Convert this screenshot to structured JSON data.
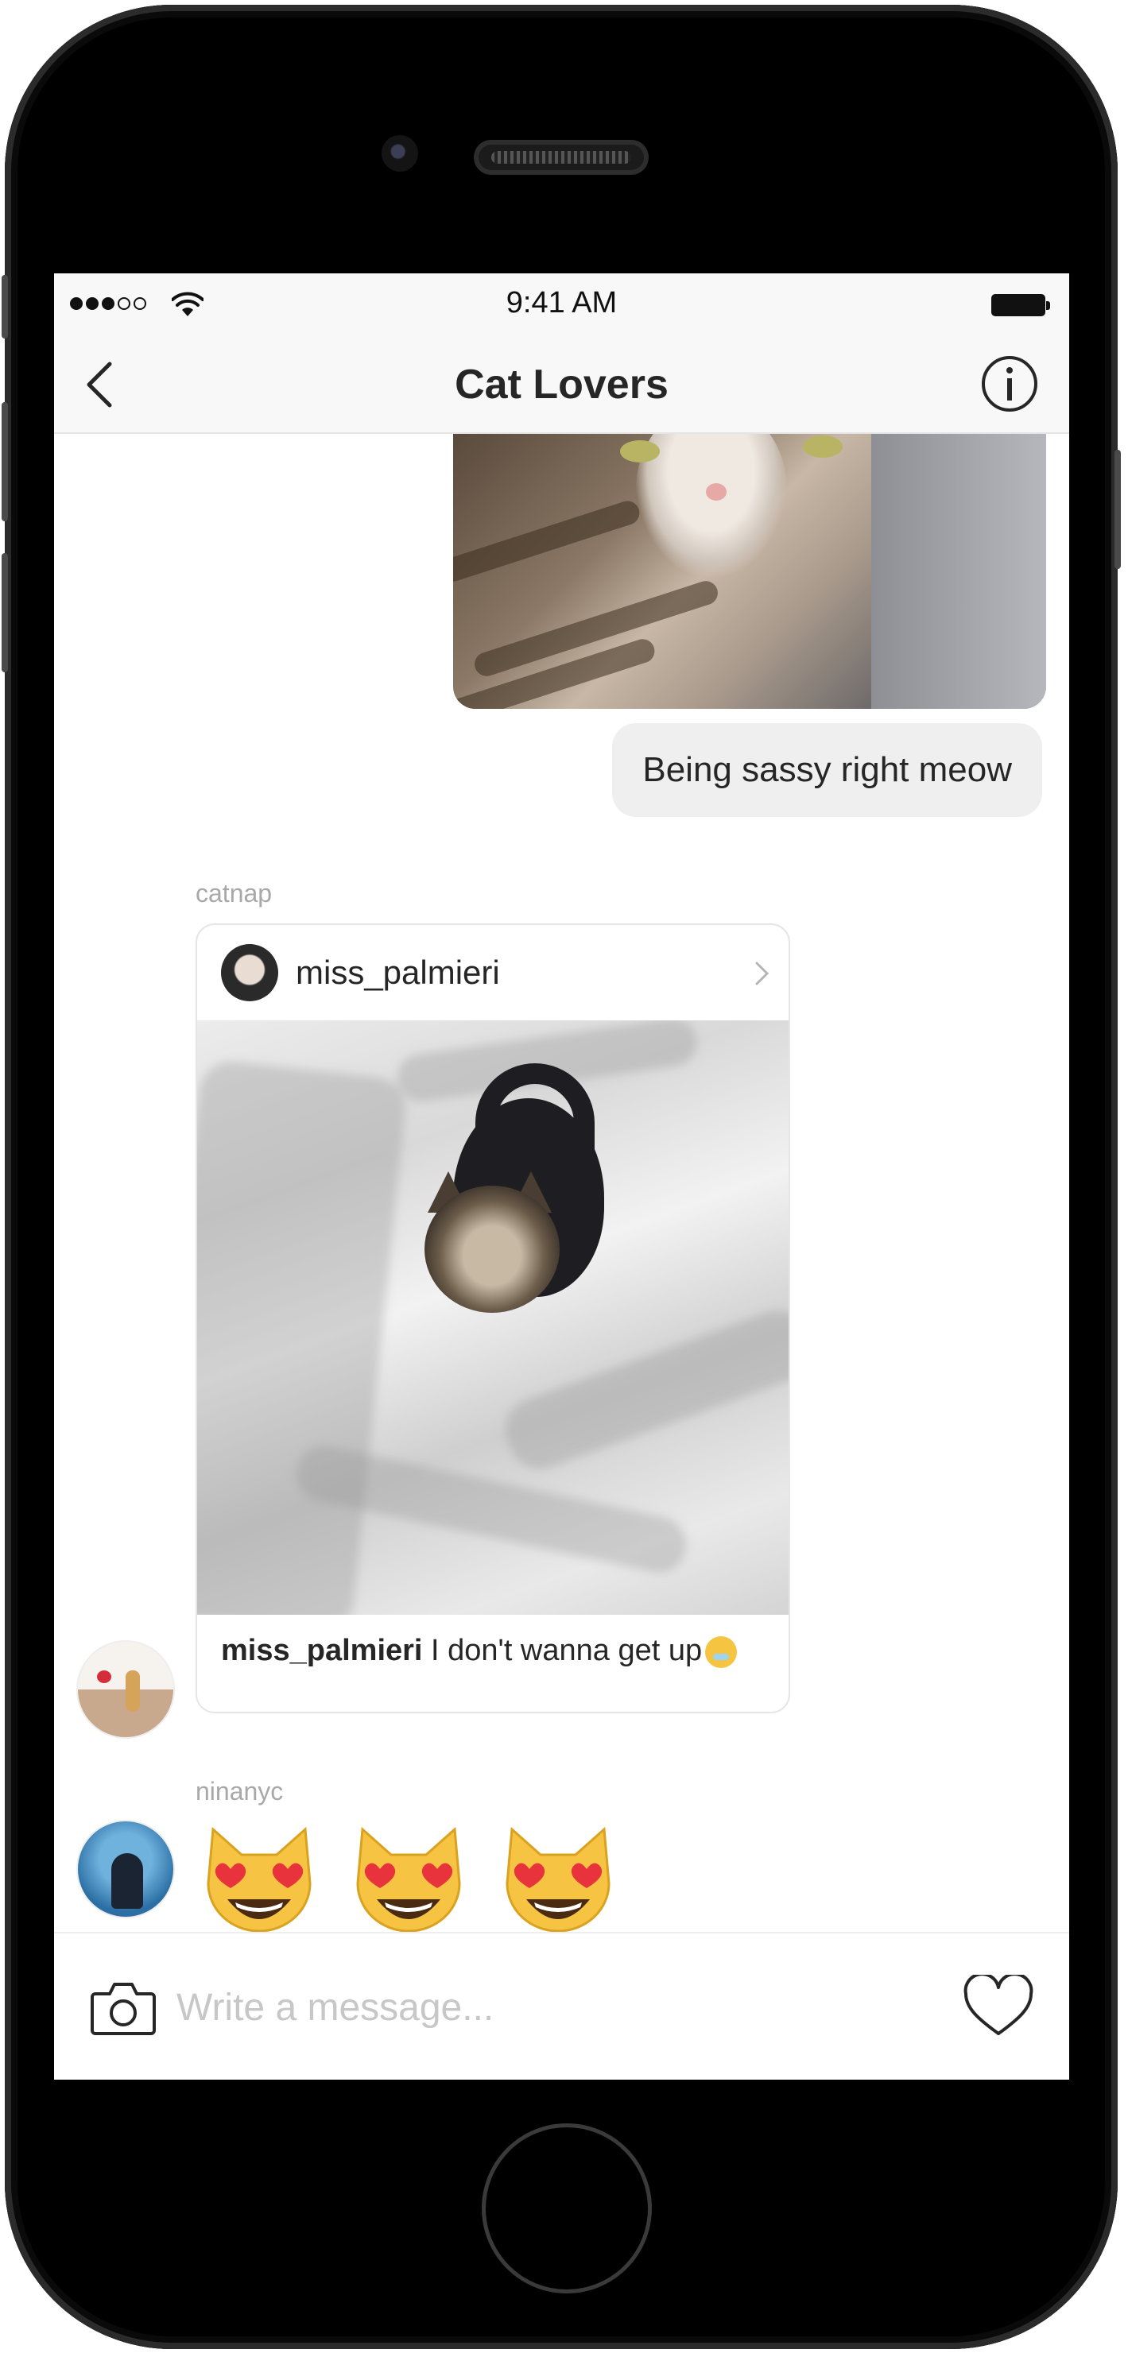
{
  "status_bar": {
    "time": "9:41 AM"
  },
  "nav": {
    "title": "Cat Lovers",
    "back_icon": "chevron-left-icon",
    "info_icon": "info-circle-icon"
  },
  "messages": {
    "sent": {
      "image_alt": "Close-up photo of a tabby and white cat",
      "text": "Being sassy right meow"
    },
    "shared_post": {
      "sender": "catnap",
      "post_username": "miss_palmieri",
      "caption_user": "miss_palmieri",
      "caption_text": " I don't wanna get up"
    },
    "emoji_message": {
      "sender": "ninanyc",
      "emojis": [
        "smiling-cat-heart-eyes",
        "smiling-cat-heart-eyes",
        "smiling-cat-heart-eyes"
      ]
    }
  },
  "composer": {
    "placeholder": "Write a message..."
  },
  "colors": {
    "bubble_gray": "#efefef",
    "text_dark": "#262626",
    "label_gray": "#a8a8a8",
    "emoji_yellow": "#f6c343",
    "heart_red": "#e8323c"
  }
}
